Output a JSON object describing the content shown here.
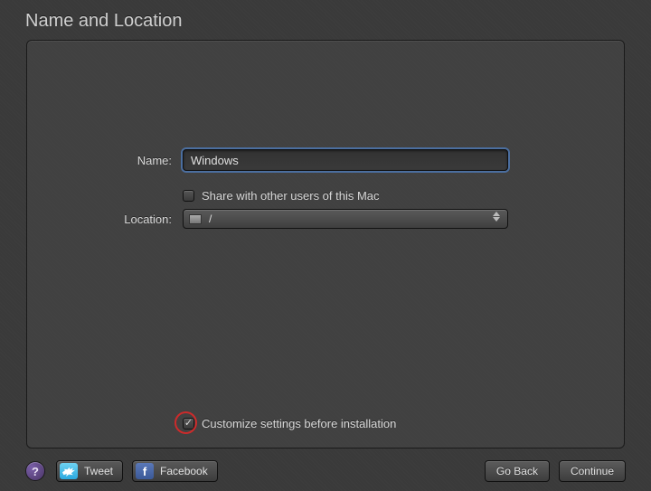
{
  "title": "Name and Location",
  "form": {
    "name_label": "Name:",
    "name_value": "Windows",
    "share_label": "Share with other users of this Mac",
    "share_checked": false,
    "location_label": "Location:",
    "location_value": "/"
  },
  "customize": {
    "label": "Customize settings before installation",
    "checked": true
  },
  "footer": {
    "help": "?",
    "tweet": "Tweet",
    "facebook": "Facebook",
    "go_back": "Go Back",
    "continue": "Continue"
  }
}
